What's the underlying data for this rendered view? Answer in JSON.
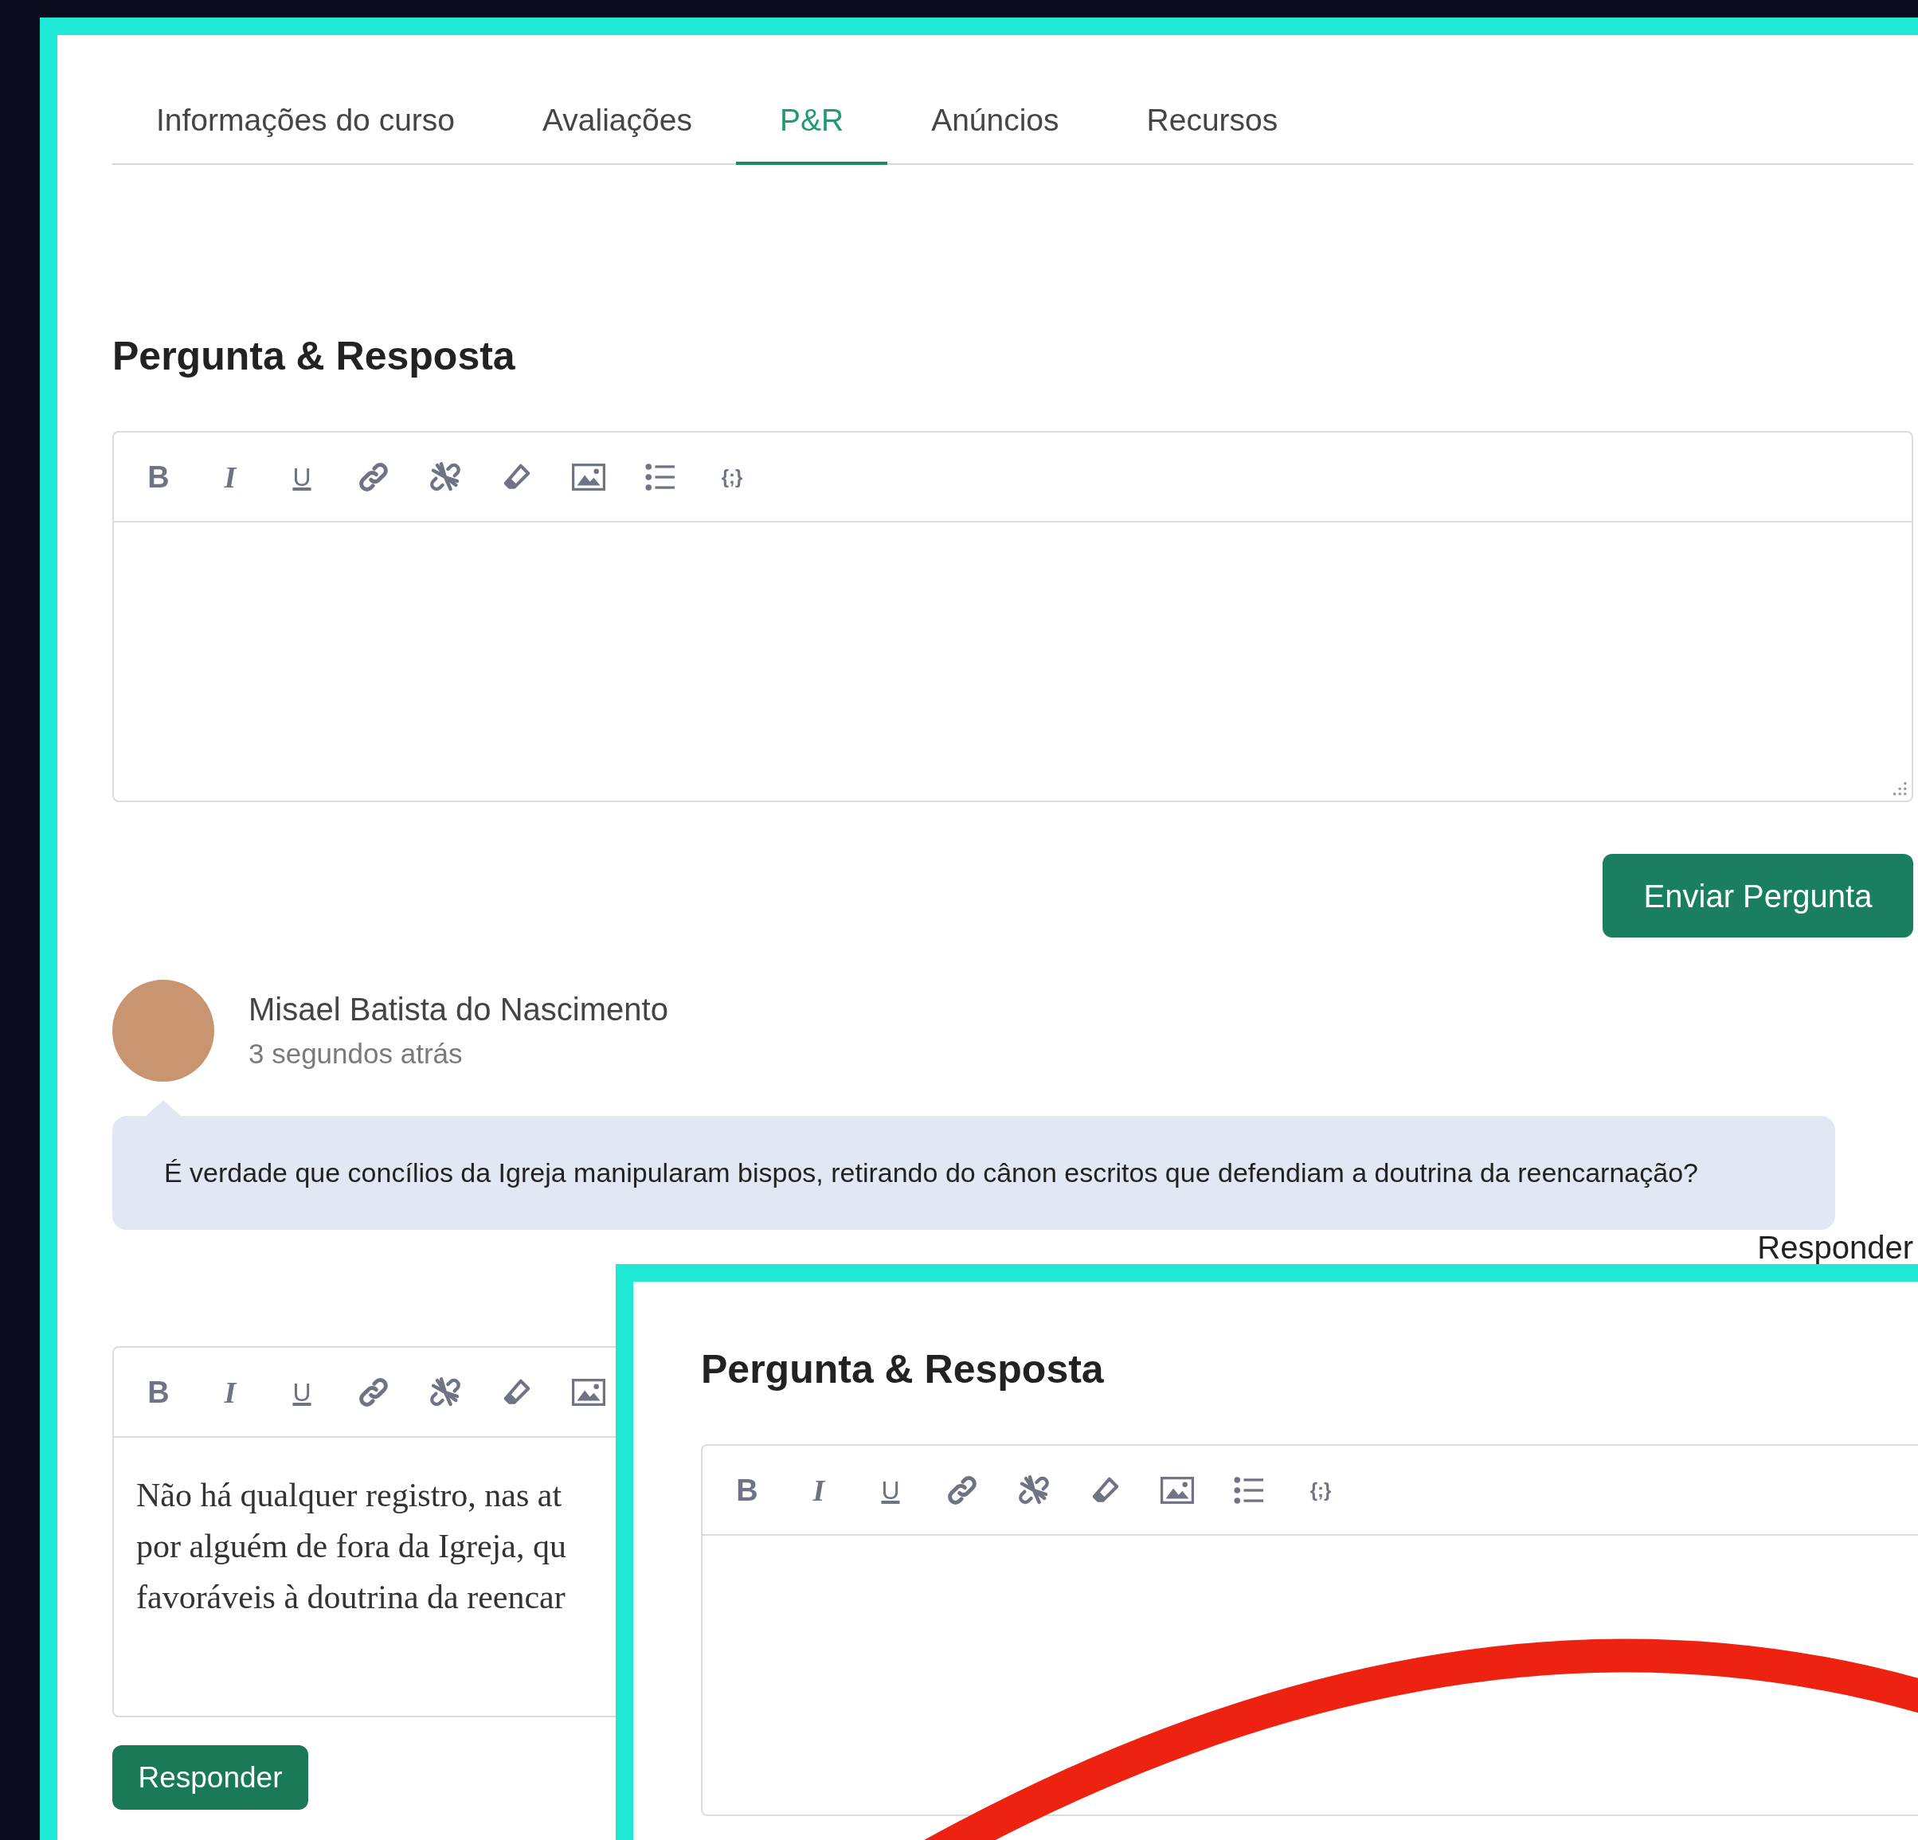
{
  "tabs": [
    {
      "label": "Informações do curso",
      "selected": false
    },
    {
      "label": "Avaliações",
      "selected": false
    },
    {
      "label": "P&R",
      "selected": true
    },
    {
      "label": "Anúncios",
      "selected": false
    },
    {
      "label": "Recursos",
      "selected": false
    }
  ],
  "qa_section": {
    "heading": "Pergunta & Resposta",
    "editor": {
      "toolbar": [
        {
          "kind": "bold",
          "label": "B"
        },
        {
          "kind": "italic",
          "label": "I"
        },
        {
          "kind": "underline",
          "label": "U"
        },
        {
          "kind": "link"
        },
        {
          "kind": "unlink"
        },
        {
          "kind": "eraser"
        },
        {
          "kind": "image"
        },
        {
          "kind": "list"
        },
        {
          "kind": "code",
          "label": "{;}"
        }
      ]
    },
    "submit_button": "Enviar Pergunta"
  },
  "question": {
    "author": "Misael Batista do Nascimento",
    "time": "3 segundos atrás",
    "text": "É verdade que concílios da Igreja manipularam bispos, retirando do cânon escritos que defendiam a doutrina da reencarnação?",
    "reply_link": "Responder"
  },
  "reply_editor": {
    "toolbar": [
      {
        "kind": "bold",
        "label": "B"
      },
      {
        "kind": "italic",
        "label": "I"
      },
      {
        "kind": "underline",
        "label": "U"
      },
      {
        "kind": "link"
      },
      {
        "kind": "unlink"
      },
      {
        "kind": "eraser"
      },
      {
        "kind": "image"
      }
    ],
    "lines": [
      "Não há qualquer registro, nas at",
      "por alguém de fora da Igreja, qu",
      "favoráveis à doutrina da reencar"
    ],
    "button": "Responder"
  },
  "overlay_screenshot": {
    "heading": "Pergunta & Resposta",
    "editor": {
      "toolbar": [
        {
          "kind": "bold",
          "label": "B"
        },
        {
          "kind": "italic",
          "label": "I"
        },
        {
          "kind": "underline",
          "label": "U"
        },
        {
          "kind": "link"
        },
        {
          "kind": "unlink"
        },
        {
          "kind": "eraser"
        },
        {
          "kind": "image"
        },
        {
          "kind": "list"
        },
        {
          "kind": "code",
          "label": "{;}"
        }
      ]
    }
  }
}
